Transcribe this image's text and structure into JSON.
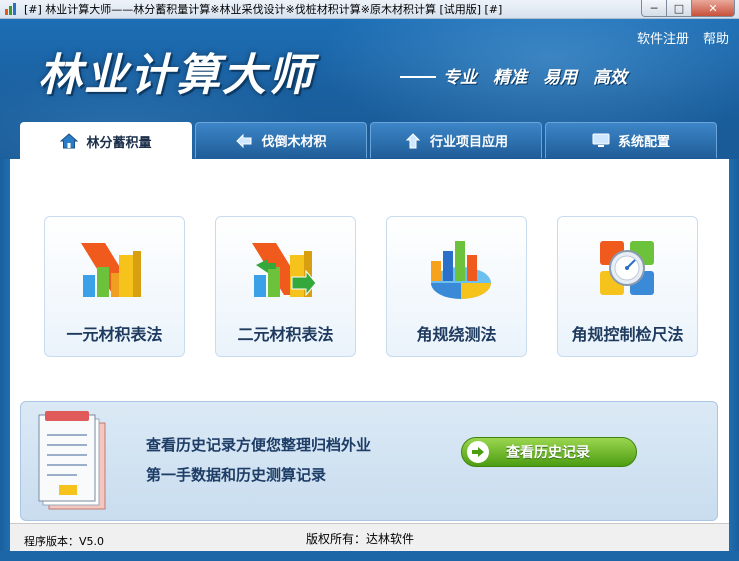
{
  "window": {
    "title": "[#] 林业计算大师——林分蓄积量计算※林业采伐设计※伐桩材积计算※原木材积计算 [试用版] [#]",
    "minimize": "─",
    "maximize": "□",
    "close": "✕"
  },
  "header": {
    "app_title": "林业计算大师",
    "links": [
      "软件注册",
      "帮助"
    ],
    "slogan": [
      "专业",
      "精准",
      "易用",
      "高效"
    ]
  },
  "tabs": [
    {
      "label": "林分蓄积量",
      "icon": "home-icon",
      "active": true
    },
    {
      "label": "伐倒木材积",
      "icon": "arrow-left-icon",
      "active": false
    },
    {
      "label": "行业项目应用",
      "icon": "arrow-up-icon",
      "active": false
    },
    {
      "label": "系统配置",
      "icon": "monitor-icon",
      "active": false
    }
  ],
  "cards": [
    {
      "label": "一元材积表法",
      "icon": "bar-chart-icon"
    },
    {
      "label": "二元材积表法",
      "icon": "bar-chart-arrow-icon"
    },
    {
      "label": "角规绕测法",
      "icon": "pie-chart-icon"
    },
    {
      "label": "角规控制检尺法",
      "icon": "gauge-icon"
    }
  ],
  "history": {
    "line1": "查看历史记录方便您整理归档外业",
    "line2": "第一手数据和历史测算记录",
    "button": "查看历史记录"
  },
  "status": {
    "version": "程序版本：V5.0",
    "copyright": "版权所有：达林软件"
  },
  "colors": {
    "header_blue": "#1d6eb5",
    "tab_blue": "#2a6fae",
    "button_green": "#5aa81c"
  }
}
